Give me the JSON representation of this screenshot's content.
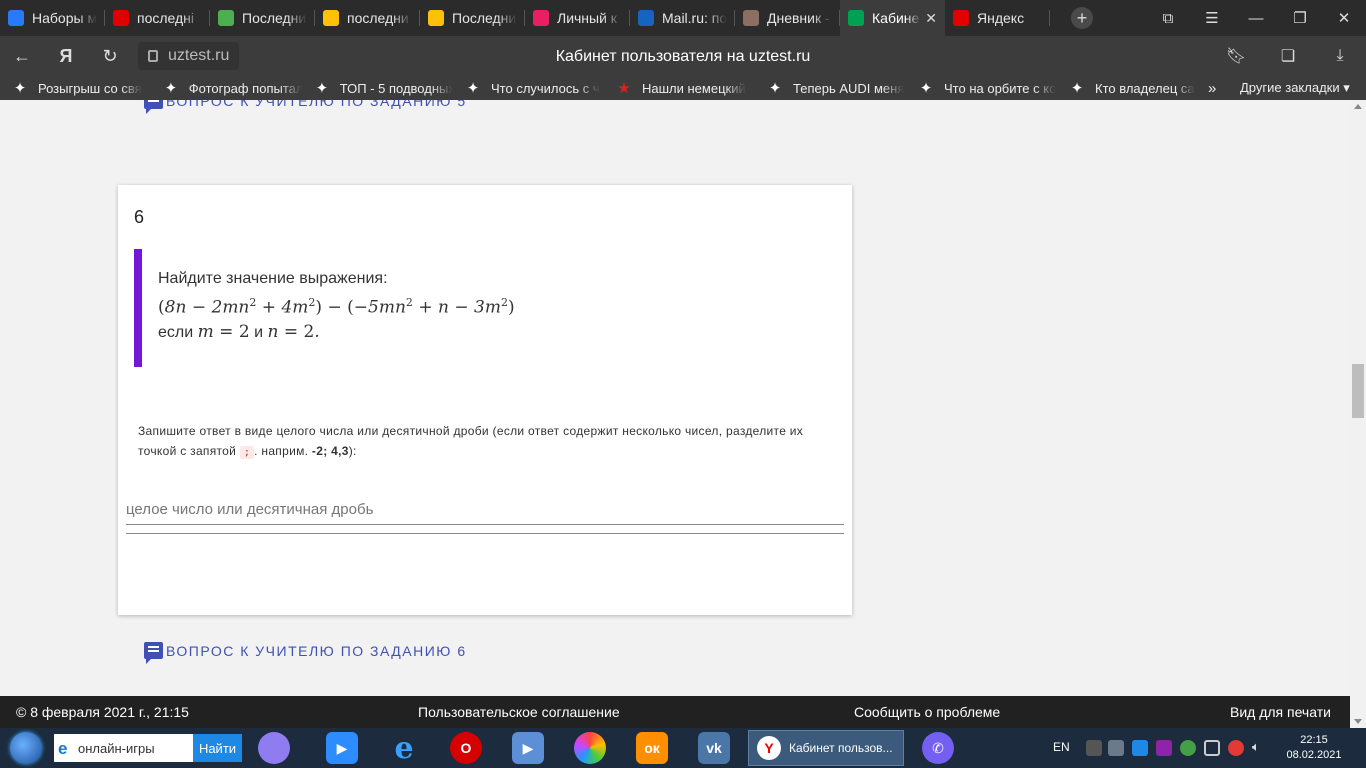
{
  "tabs": [
    {
      "title": "Наборы м",
      "icon": "tab-favicon",
      "color": "#2979ff"
    },
    {
      "title": "последні",
      "icon": "yandex-icon",
      "color": "#e00000"
    },
    {
      "title": "Последни",
      "icon": "hd-icon",
      "color": "#4caf50"
    },
    {
      "title": "последни",
      "icon": "play-icon",
      "color": "#ffc107"
    },
    {
      "title": "Последни",
      "icon": "play-icon",
      "color": "#ffc107"
    },
    {
      "title": "Личный к",
      "icon": "dots-icon",
      "color": "#e91e63"
    },
    {
      "title": "Mail.ru: по",
      "icon": "mailru-icon",
      "color": "#1565c0"
    },
    {
      "title": "Дневник -",
      "icon": "hand-icon",
      "color": "#8d6e63"
    },
    {
      "title": "Кабине",
      "icon": "uztest-icon",
      "color": "#00a152",
      "active": true
    },
    {
      "title": "Яндекс",
      "icon": "yandex-icon",
      "color": "#e00000"
    }
  ],
  "address": {
    "url": "uztest.ru",
    "page_title": "Кабинет пользователя на uztest.ru"
  },
  "bookmarks": [
    "Розыгрыш со свя",
    "Фотограф попытал",
    "ТОП - 5 подводных",
    "Что случилось с ч",
    "Нашли немецкий",
    "Теперь AUDI меня",
    "Что на орбите с ко",
    "Кто владелец са"
  ],
  "bookmarks_other": "Другие закладки",
  "page": {
    "prev_teacher_link": "ВОПРОС К УЧИТЕЛЮ ПО ЗАДАНИЮ 5",
    "next_teacher_link": "ВОПРОС К УЧИТЕЛЮ ПО ЗАДАНИЮ 6",
    "question": {
      "number": "6",
      "prompt": "Найдите значение выражения:",
      "condition_prefix": "если",
      "condition_and": "и",
      "hint_text": "Запишите ответ в виде целого числа или десятичной дроби (если ответ содержит несколько чисел, разделите их точкой с запятой",
      "hint_sep": ";",
      "hint_example_prefix": ". наприм.",
      "hint_example": "-2; 4,3",
      "hint_end": "):",
      "answer_placeholder": "целое число или десятичная дробь"
    },
    "accent_color": "#7318d9",
    "link_color": "#3f51b5"
  },
  "footer": {
    "copyright": "© 8 февраля 2021 г., 21:15",
    "agreement": "Пользовательское соглашение",
    "report": "Сообщить о проблеме",
    "print": "Вид для печати"
  },
  "taskbar": {
    "search_placeholder": "онлайн-игры",
    "search_button": "Найти",
    "active_task": "Кабинет пользов...",
    "lang": "EN",
    "time": "22:15",
    "date": "08.02.2021"
  }
}
